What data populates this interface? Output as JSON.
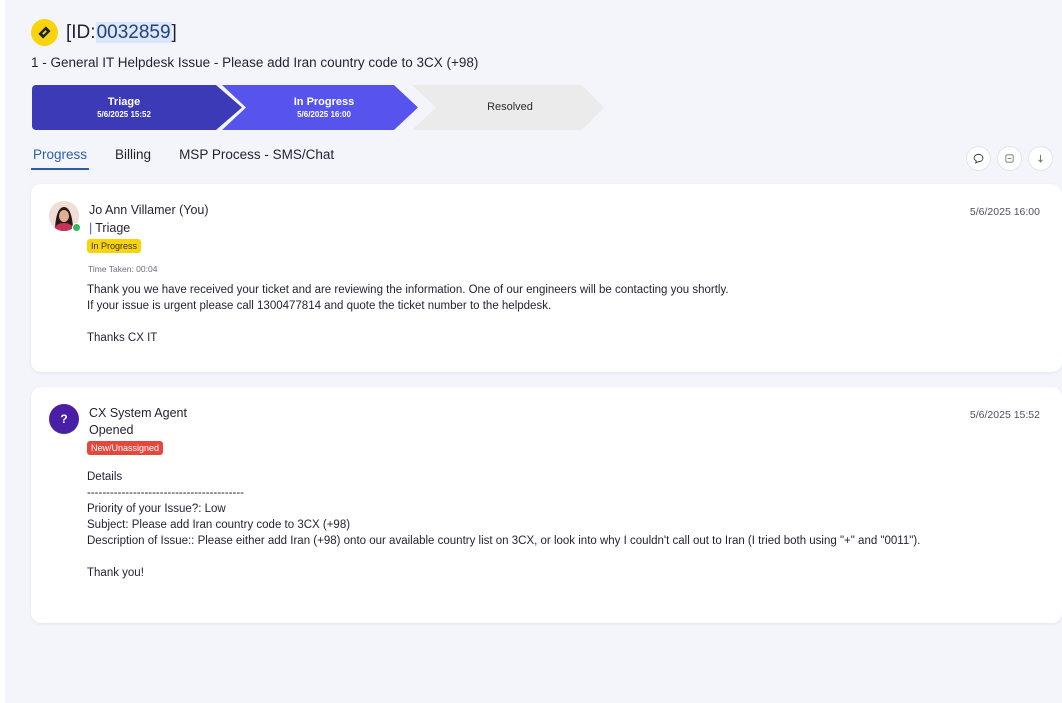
{
  "header": {
    "id_prefix": "[ID:",
    "id_number": "0032859",
    "id_suffix": "]",
    "subtitle": "1 - General IT Helpdesk Issue - Please add Iran country code to 3CX (+98)"
  },
  "stages": [
    {
      "name": "Triage",
      "date": "5/6/2025 15:52",
      "color": "#3d3ab8"
    },
    {
      "name": "In Progress",
      "date": "5/6/2025 16:00",
      "color": "#5654ec"
    },
    {
      "name": "Resolved",
      "date": "",
      "color": "#ebebeb"
    }
  ],
  "tabs": [
    {
      "label": "Progress"
    },
    {
      "label": "Billing"
    },
    {
      "label": "MSP Process - SMS/Chat"
    }
  ],
  "tools": [
    "chat-bubble-icon",
    "collapse-icon",
    "sort-down-icon"
  ],
  "entries": [
    {
      "author": "Jo Ann Villamer (You)",
      "stage": "Triage",
      "badge": "In Progress",
      "time_taken": "Time Taken: 00:04",
      "timestamp": "5/6/2025 16:00",
      "body": "Thank you we have received your ticket and are reviewing the information. One of our engineers will be contacting you shortly.\nIf your issue is urgent please call 1300477814 and quote the ticket number to the helpdesk.\n\nThanks CX IT"
    },
    {
      "author": "CX System Agent",
      "avatar_letter": "?",
      "stage": "Opened",
      "badge": "New/Unassigned",
      "timestamp": "5/6/2025 15:52",
      "body": "Details\n-----------------------------------------\nPriority of your Issue?: Low\nSubject: Please add Iran country code to 3CX (+98)\nDescription of Issue:: Please either add Iran (+98) onto our available country list on 3CX, or look into why I couldn't call out to Iran (I tried both using \"+\" and \"0011\").\n\nThank you!"
    }
  ],
  "colors": {
    "accent": "#2d5fa8",
    "badge_in_progress": "#f8d40c",
    "badge_new": "#e5473d",
    "online": "#2ebb5a"
  }
}
